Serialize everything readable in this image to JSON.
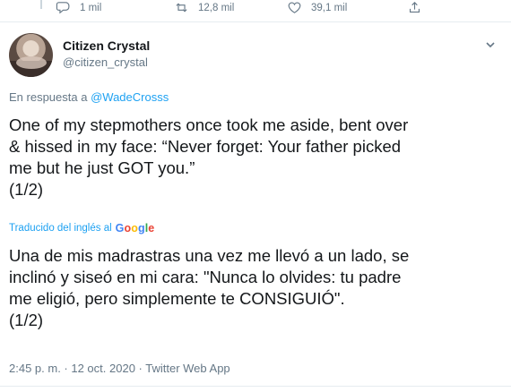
{
  "actions": {
    "reply_count": "1 mil",
    "retweet_count": "12,8 mil",
    "like_count": "39,1 mil"
  },
  "user": {
    "display_name": "Citizen Crystal",
    "handle": "@citizen_crystal"
  },
  "reply_to": {
    "prefix": "En respuesta a",
    "mention": "@WadeCrosss"
  },
  "tweet": {
    "text": "One of my stepmothers once took me aside, bent over\n& hissed in my face: “Never forget: Your father picked\nme but he just GOT you.”\n(1/2)"
  },
  "translation": {
    "label": "Traducido del inglés al",
    "provider": "Google",
    "text": "Una de mis madrastras una vez me llevó a un lado, se\ninclinó y siseó en mi cara: \"Nunca lo olvides: tu padre\nme eligió, pero simplemente te CONSIGUIÓ\".\n (1/2)"
  },
  "meta": {
    "timestamp": "2:45 p. m. · 12 oct. 2020 · Twitter Web App"
  },
  "colors": {
    "accent": "#1da1f2",
    "secondary_text": "#657786",
    "primary_text": "#14171a"
  },
  "icons": [
    "reply-icon",
    "retweet-icon",
    "like-icon",
    "share-icon",
    "chevron-down-icon"
  ]
}
